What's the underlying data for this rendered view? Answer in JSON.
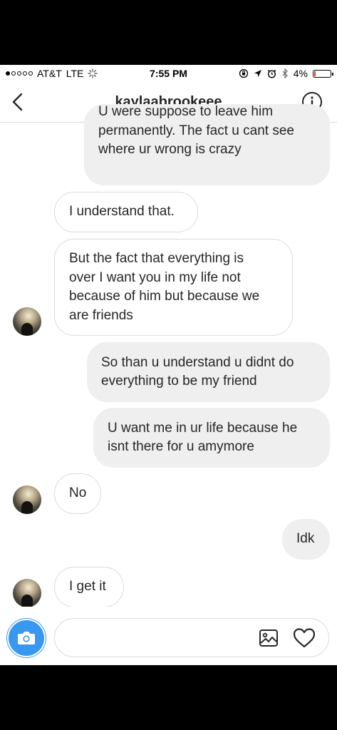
{
  "status_bar": {
    "carrier": "AT&T",
    "network": "LTE",
    "time": "7:55 PM",
    "battery": "4%",
    "signal_bars_filled": 1,
    "signal_bars_total": 5
  },
  "header": {
    "title": "kaylaabrookeee",
    "back_icon": "chevron-left-icon",
    "info_icon": "info-icon"
  },
  "messages": [
    {
      "direction": "outgoing",
      "lines": [
        "U were suppose to leave him",
        "permanently. The fact u cant see",
        "where ur wrong is crazy"
      ]
    },
    {
      "direction": "incoming",
      "lines": [
        "I understand that."
      ]
    },
    {
      "direction": "incoming",
      "lines": [
        "But the fact that everything is",
        "over I want you in my life not",
        "because of him but because we",
        "are friends"
      ]
    },
    {
      "direction": "outgoing",
      "lines": [
        "So than u understand u didnt do",
        "everything to be my friend"
      ]
    },
    {
      "direction": "outgoing",
      "lines": [
        "U want me in ur life because he",
        "isnt there for u amymore"
      ]
    },
    {
      "direction": "incoming",
      "lines": [
        "No"
      ]
    },
    {
      "direction": "outgoing",
      "lines": [
        "Idk"
      ]
    },
    {
      "direction": "incoming",
      "lines": [
        "I get it"
      ]
    }
  ],
  "composer": {
    "placeholder": "",
    "camera_icon": "camera-icon",
    "gallery_icon": "gallery-icon",
    "heart_icon": "heart-icon"
  },
  "colors": {
    "accent": "#3897f0",
    "outgoing_bubble": "#efefef",
    "incoming_border": "#dbdbdb",
    "battery_low": "#e0302b"
  }
}
